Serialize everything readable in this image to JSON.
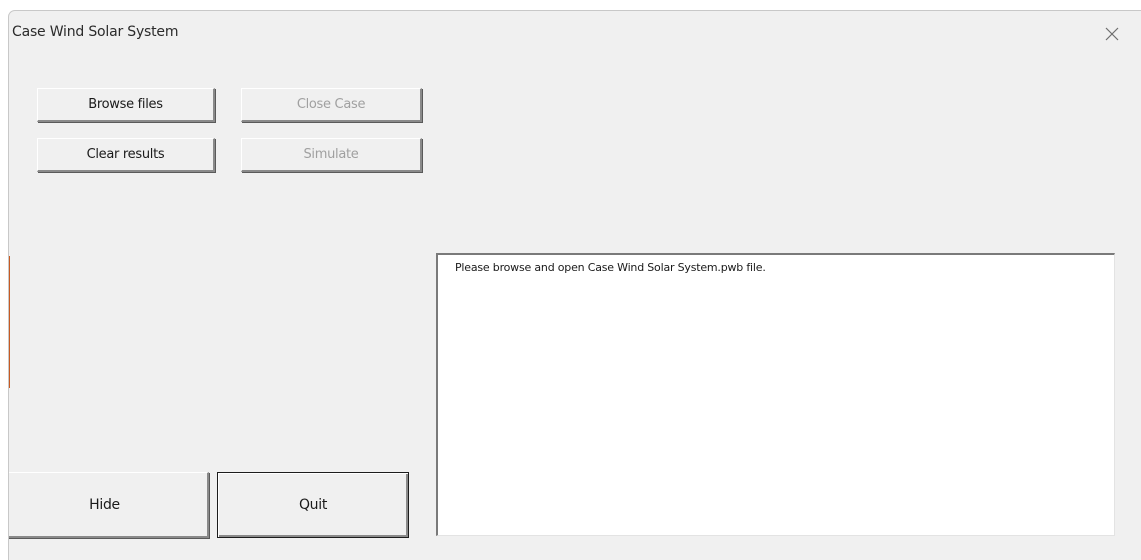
{
  "window": {
    "title": "Case Wind Solar System"
  },
  "buttons": {
    "browse_files": "Browse files",
    "close_case": "Close Case",
    "clear_results": "Clear results",
    "simulate": "Simulate",
    "hide": "Hide",
    "quit": "Quit"
  },
  "log": {
    "message": "Please browse and open Case Wind Solar System.pwb file."
  },
  "icons": {
    "close": "close-icon"
  },
  "colors": {
    "background": "#f0f0f0",
    "disabled_text": "#a0a0a0",
    "accent_edge": "#c75a22"
  }
}
